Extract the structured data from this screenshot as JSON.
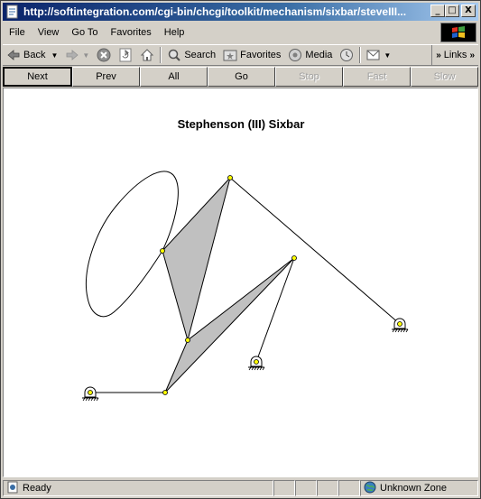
{
  "window": {
    "title": "http://softintegration.com/cgi-bin/chcgi/toolkit/mechanism/sixbar/steveIII...",
    "buttons": {
      "minimize": "_",
      "maximize": "□",
      "close": "X"
    }
  },
  "menubar": [
    "File",
    "View",
    "Go To",
    "Favorites",
    "Help"
  ],
  "toolbar": {
    "back": "Back",
    "search": "Search",
    "favorites": "Favorites",
    "media": "Media",
    "links": "Links"
  },
  "navbar": {
    "buttons": [
      "Next",
      "Prev",
      "All",
      "Go",
      "Stop",
      "Fast",
      "Slow"
    ]
  },
  "figure": {
    "title": "Stephenson (III) Sixbar"
  },
  "status": {
    "text": "Ready",
    "zone": "Unknown Zone"
  },
  "colors": {
    "link_fill": "#c0c0c0",
    "joint": "#ffff00",
    "title_active": "#0a246a"
  }
}
